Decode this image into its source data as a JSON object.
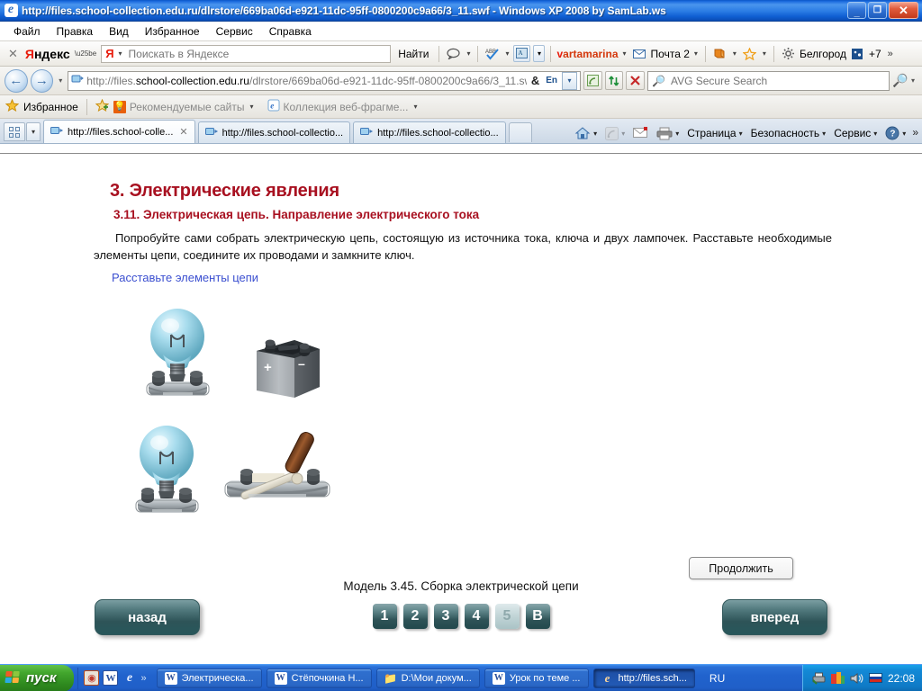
{
  "window": {
    "title": "http://files.school-collection.edu.ru/dlrstore/669ba06d-e921-11dc-95ff-0800200c9a66/3_11.swf - Windows XP 2008 by SamLab.ws",
    "app_icon": "internet-explorer-icon",
    "minimize_label": "_",
    "restore_label": "❐",
    "close_label": "✕"
  },
  "menubar": {
    "items": [
      {
        "label": "Файл"
      },
      {
        "label": "Правка"
      },
      {
        "label": "Вид"
      },
      {
        "label": "Избранное"
      },
      {
        "label": "Сервис"
      },
      {
        "label": "Справка"
      }
    ]
  },
  "yandex_bar": {
    "close_label": "✕",
    "logo_first": "Я",
    "logo_rest": "ндекс",
    "search_badge": "Я",
    "search_placeholder": "Поискать в Яндексе",
    "search_value": "",
    "find_label": "Найти",
    "comment_icon": "speech-bubble-icon",
    "spell_icon": "spellcheck-icon",
    "translate_icon": "translate-icon",
    "user_v": "v",
    "user_name": "artamarina",
    "mail_label": "Почта 2",
    "mail_icon": "envelope-icon",
    "bookmarks_icon": "bookmarks-icon",
    "star_icon": "star-outline-icon",
    "gear_icon": "gear-icon",
    "city_label": "Белгород",
    "weather_label": "+7",
    "overflow_label": "»"
  },
  "navbar": {
    "back_icon": "back-arrow-icon",
    "forward_icon": "forward-arrow-icon",
    "history_caret": "▾",
    "address_icon": "page-icon",
    "url_prefix": "http://files.",
    "url_host": "school-collection.edu.ru",
    "url_rest": "/dlrstore/669ba06d-e921-11dc-95ff-0800200c9a66/3_11.swf",
    "amp_tool": "&",
    "lang_tool": "En",
    "dropdown_caret": "⌄",
    "rss_icon": "rss-feed-icon",
    "refresh_icon": "refresh-icon",
    "stop_icon": "stop-icon",
    "avg_placeholder": "AVG Secure Search",
    "avg_value": "",
    "avg_search_icon": "magnifier-icon",
    "avg_caret": "▾"
  },
  "favbar": {
    "star_icon": "favorites-star-icon",
    "favorites_label": "Избранное",
    "add_icon": "add-to-favorites-icon",
    "items": [
      {
        "label": "Рекомендуемые сайты",
        "icon": "lightbulb-icon",
        "caret": "▾"
      },
      {
        "label": "Коллекция веб-фрагме...",
        "icon": "internet-explorer-icon",
        "caret": "▾"
      }
    ]
  },
  "tabbar": {
    "quicktabs_icon": "quick-tabs-icon",
    "tablist_caret": "▾",
    "tabs": [
      {
        "title": "http://files.school-colle...",
        "icon": "page-icon",
        "active": true,
        "close": "✕"
      },
      {
        "title": "http://files.school-collectio...",
        "icon": "page-icon",
        "active": false,
        "close": ""
      },
      {
        "title": "http://files.school-collectio...",
        "icon": "page-icon",
        "active": false,
        "close": ""
      }
    ],
    "new_tab_label": ""
  },
  "commandbar": {
    "home_icon": "home-icon",
    "feeds_icon": "rss-feed-icon",
    "mail_icon": "read-mail-icon",
    "print_icon": "printer-icon",
    "items": [
      {
        "label": "Страница",
        "caret": "▾"
      },
      {
        "label": "Безопасность",
        "caret": "▾"
      },
      {
        "label": "Сервис",
        "caret": "▾"
      }
    ],
    "help_icon": "help-icon",
    "overflow": "»"
  },
  "content": {
    "chapter_title": "3. Электрические явления",
    "section_title": "3.11. Электрическая цепь. Направление электрического тока",
    "paragraph": "Попробуйте сами собрать электрическую цепь, состоящую из источника тока, ключа и двух лампочек. Расставьте необходимые элементы цепи, соедините их проводами и замкните ключ.",
    "task_link": "Расставьте элементы цепи",
    "elements": [
      {
        "name": "lamp-1",
        "kind": "lamp"
      },
      {
        "name": "battery",
        "kind": "battery",
        "plus": "+",
        "minus": "–"
      },
      {
        "name": "lamp-2",
        "kind": "lamp"
      },
      {
        "name": "switch",
        "kind": "switch"
      }
    ],
    "model_caption": "Модель 3.45. Сборка электрической цепи",
    "page_buttons": [
      {
        "label": "1",
        "current": false
      },
      {
        "label": "2",
        "current": false
      },
      {
        "label": "3",
        "current": false
      },
      {
        "label": "4",
        "current": false
      },
      {
        "label": "5",
        "current": true
      },
      {
        "label": "В",
        "current": false
      }
    ],
    "back_button": "назад",
    "forward_button": "вперед",
    "continue_button": "Продолжить"
  },
  "taskbar": {
    "start_label": "пуск",
    "quick_launch": [
      {
        "icon": "media-player-icon",
        "glyph": "◉"
      },
      {
        "icon": "word-icon",
        "glyph": "W"
      },
      {
        "icon": "internet-explorer-icon",
        "glyph": "e"
      }
    ],
    "quick_overflow": "»",
    "buttons": [
      {
        "label": "Электрическа...",
        "icon": "word-icon",
        "active": false
      },
      {
        "label": "Стёпочкина Н...",
        "icon": "word-icon",
        "active": false
      },
      {
        "label": "D:\\Мои докум...",
        "icon": "folder-icon",
        "active": false
      },
      {
        "label": "Урок по теме ...",
        "icon": "word-icon",
        "active": false
      },
      {
        "label": "http://files.sch...",
        "icon": "internet-explorer-icon",
        "active": true
      }
    ],
    "language": "RU",
    "tray_icons": [
      {
        "icon": "printer-tray-icon",
        "glyph": "⎙"
      },
      {
        "icon": "colorful-app-icon",
        "glyph": "▣"
      },
      {
        "icon": "volume-icon",
        "glyph": "🔊"
      }
    ],
    "flag_icon": "russian-flag-icon",
    "clock": "22:08"
  }
}
